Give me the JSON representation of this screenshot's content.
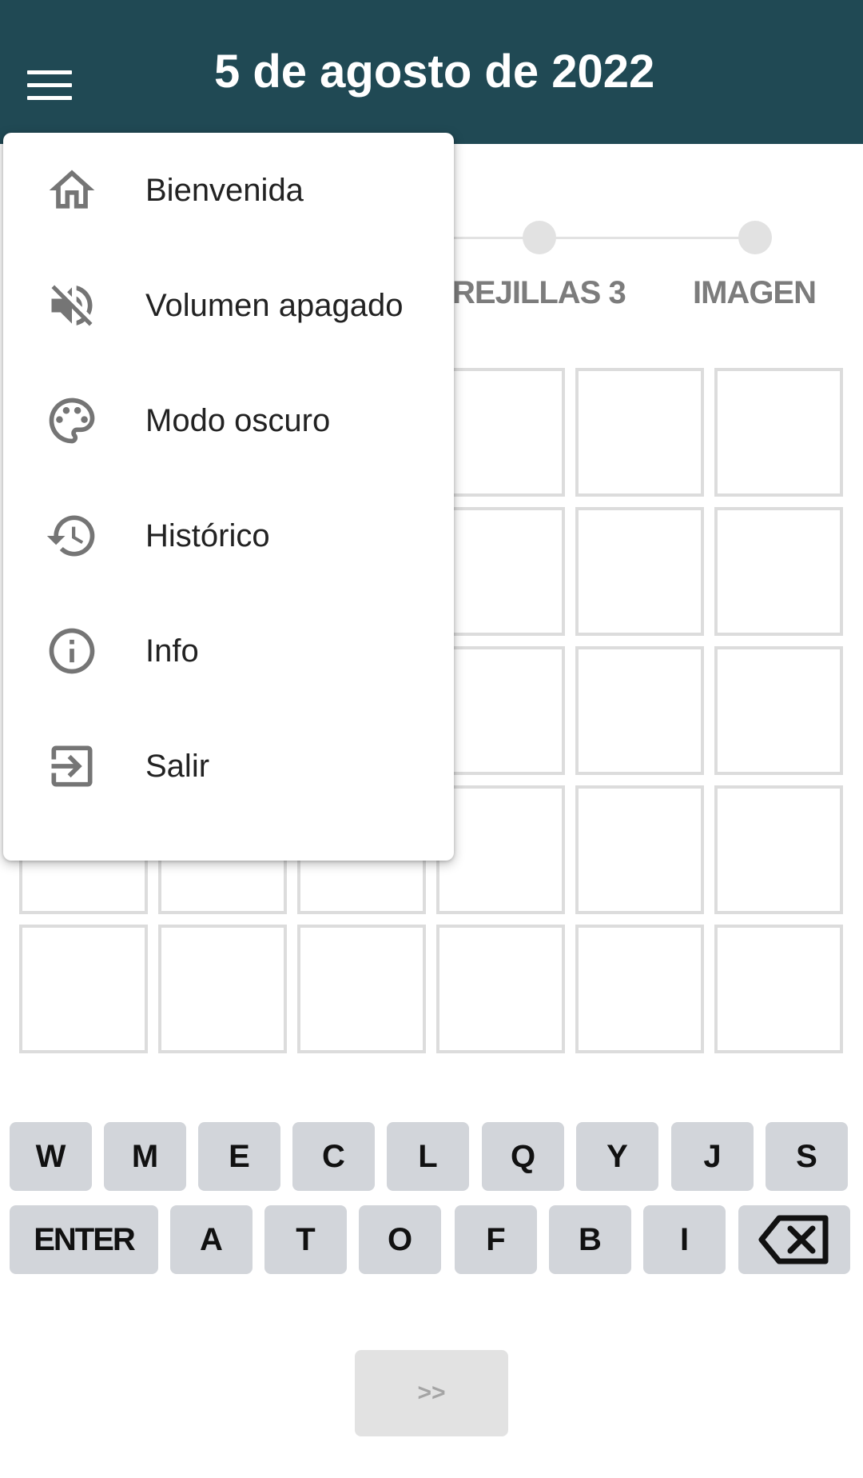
{
  "header": {
    "title": "5 de agosto de 2022",
    "background_color": "#204954",
    "menu_icon": "hamburger-menu-icon"
  },
  "stepper": {
    "steps": [
      {
        "label": "REJILLAS 3"
      },
      {
        "label": "IMAGEN"
      }
    ]
  },
  "menu": {
    "items": [
      {
        "label": "Bienvenida",
        "icon": "home-icon"
      },
      {
        "label": "Volumen apagado",
        "icon": "volume-off-icon"
      },
      {
        "label": "Modo oscuro",
        "icon": "palette-icon"
      },
      {
        "label": "Histórico",
        "icon": "history-icon"
      },
      {
        "label": "Info",
        "icon": "info-icon"
      },
      {
        "label": "Salir",
        "icon": "logout-icon"
      }
    ]
  },
  "keyboard": {
    "row1": [
      "W",
      "M",
      "E",
      "C",
      "L",
      "Q",
      "Y",
      "J",
      "S"
    ],
    "row2": [
      "ENTER",
      "A",
      "T",
      "O",
      "F",
      "B",
      "I"
    ],
    "backspace_icon": "backspace-icon"
  },
  "next_button": {
    "label": ">>"
  }
}
